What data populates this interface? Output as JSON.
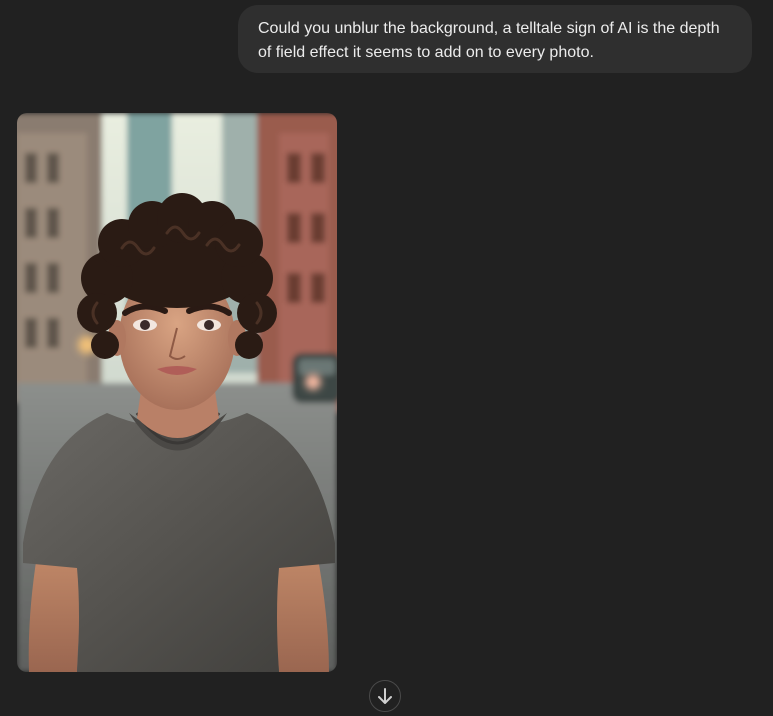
{
  "conversation": {
    "user_message": "Could you unblur the background, a telltale sign of AI is the depth of field effect it seems to add on to every photo."
  },
  "image": {
    "subject": "AI-generated portrait of a young man with curly hair in a grey t-shirt on a city street",
    "icon": "generated-image"
  },
  "scroll_button": {
    "icon": "arrow-down-icon"
  },
  "colors": {
    "background": "#212121",
    "bubble": "#2f2f2f",
    "text": "#ececec"
  }
}
